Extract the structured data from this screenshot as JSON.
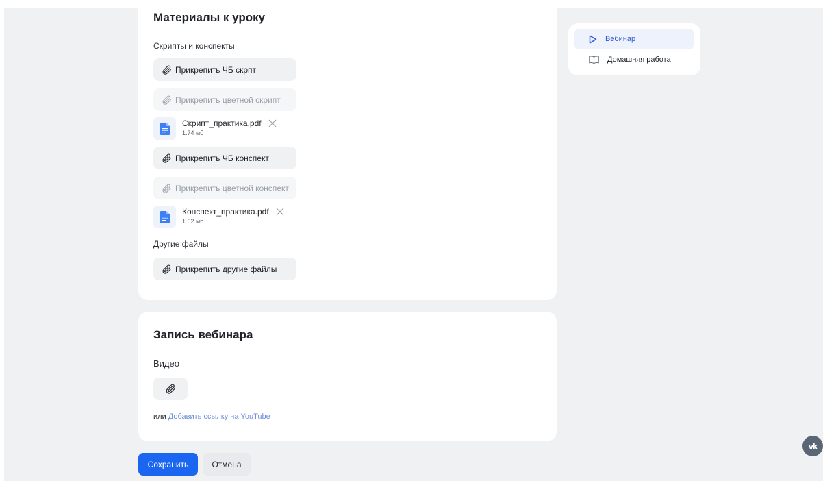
{
  "materials": {
    "title": "Материалы к уроку",
    "scripts_label": "Скрипты и конспекты",
    "attach_bw_script": "Прикрепить ЧБ скрпт",
    "attach_color_script": "Прикрепить цветной скрипт",
    "script_file": {
      "name": "Скрипт_практика.pdf",
      "size": "1.74 мб"
    },
    "attach_bw_notes": "Прикрепить ЧБ конспект",
    "attach_color_notes": "Прикрепить цветной конспект",
    "notes_file": {
      "name": "Конспект_практика.pdf",
      "size": "1.62 мб"
    },
    "other_label": "Другие файлы",
    "attach_other": "Прикрепить другие файлы"
  },
  "recording": {
    "title": "Запись вебинара",
    "video_label": "Видео",
    "or_text": "или",
    "youtube_link": "Добавить ссылку на YouTube"
  },
  "side_nav": {
    "items": [
      {
        "label": "Вебинар",
        "icon": "play-icon",
        "active": true
      },
      {
        "label": "Домашняя работа",
        "icon": "book-icon",
        "active": false
      }
    ]
  },
  "actions": {
    "save": "Сохранить",
    "cancel": "Отмена"
  },
  "vk_widget": {
    "label": "vk"
  },
  "colors": {
    "accent": "#1a66f0",
    "link": "#6f8fd8",
    "file_icon": "#3d7ff5"
  }
}
